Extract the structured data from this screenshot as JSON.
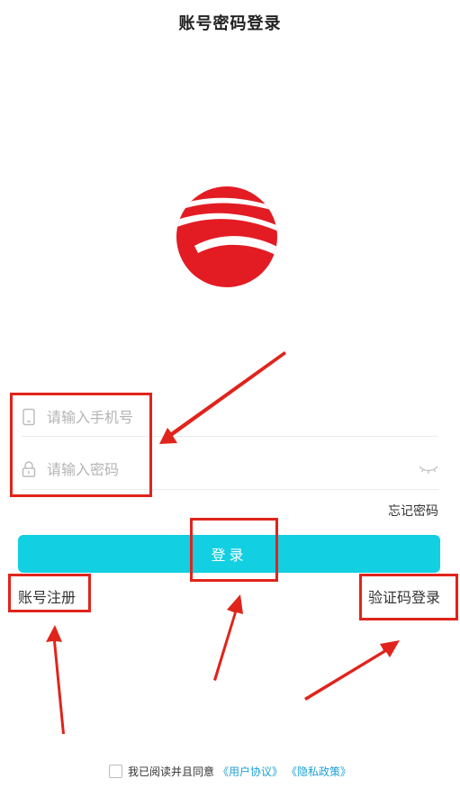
{
  "header": {
    "title": "账号密码登录"
  },
  "logo": {
    "name": "red-circle-logo",
    "color": "#e31c24"
  },
  "form": {
    "phone": {
      "placeholder": "请输入手机号",
      "icon": "phone-icon"
    },
    "password": {
      "placeholder": "请输入密码",
      "icon": "lock-icon",
      "toggle_icon": "eye-closed-icon"
    },
    "forgot_label": "忘记密码",
    "login_label": "登录",
    "register_label": "账号注册",
    "code_login_label": "验证码登录"
  },
  "agreement": {
    "text": "我已阅读并且同意",
    "user_agreement": "《用户协议》",
    "privacy_policy": "《隐私政策》",
    "checked": false
  },
  "colors": {
    "accent": "#12cfe2",
    "annotation": "#e0241b",
    "link": "#1da1d8"
  }
}
